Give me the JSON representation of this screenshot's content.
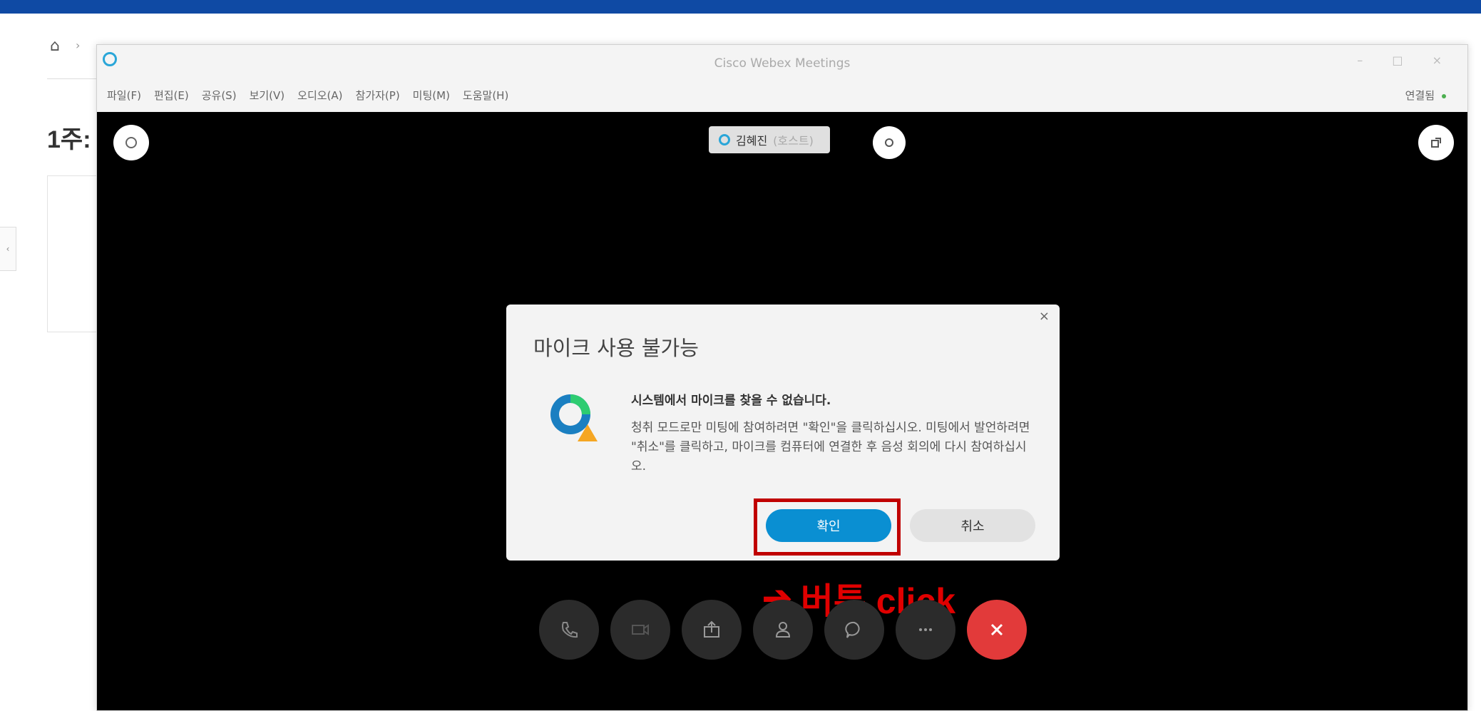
{
  "background_page": {
    "heading": "1주:",
    "side_toggle": "‹"
  },
  "window": {
    "title": "Cisco Webex Meetings",
    "controls": "– □ ×",
    "menu": [
      "파일(F)",
      "편집(E)",
      "공유(S)",
      "보기(V)",
      "오디오(A)",
      "참가자(P)",
      "미팅(M)",
      "도움말(H)"
    ],
    "connection": "연결됨"
  },
  "presenter": {
    "name": "김혜진",
    "role": "(호스트)"
  },
  "dialog": {
    "title": "마이크 사용 불가능",
    "message_title": "시스템에서 마이크를 찾을 수 없습니다.",
    "message_body": "청취 모드로만 미팅에 참여하려면 \"확인\"을 클릭하십시오. 미팅에서 발언하려면 \"취소\"를 클릭하고, 마이크를 컴퓨터에 연결한 후 음성 회의에 다시 참여하십시오.",
    "ok_label": "확인",
    "cancel_label": "취소",
    "close": "×"
  },
  "annotation": {
    "arrow": "➔",
    "text": "버튼 click",
    "color": "#e00000"
  },
  "controls": [
    {
      "name": "audio-button",
      "icon": "phone-icon"
    },
    {
      "name": "video-button",
      "icon": "camera-icon"
    },
    {
      "name": "share-button",
      "icon": "share-icon"
    },
    {
      "name": "participants-button",
      "icon": "participants-icon"
    },
    {
      "name": "chat-button",
      "icon": "chat-icon"
    },
    {
      "name": "more-button",
      "icon": "more-icon"
    },
    {
      "name": "leave-button",
      "icon": "close-icon"
    }
  ],
  "colors": {
    "top_bar": "#0f4aa4",
    "ok_button": "#0a8fd2",
    "highlight": "#c00000",
    "leave_button": "#e23a3a"
  }
}
